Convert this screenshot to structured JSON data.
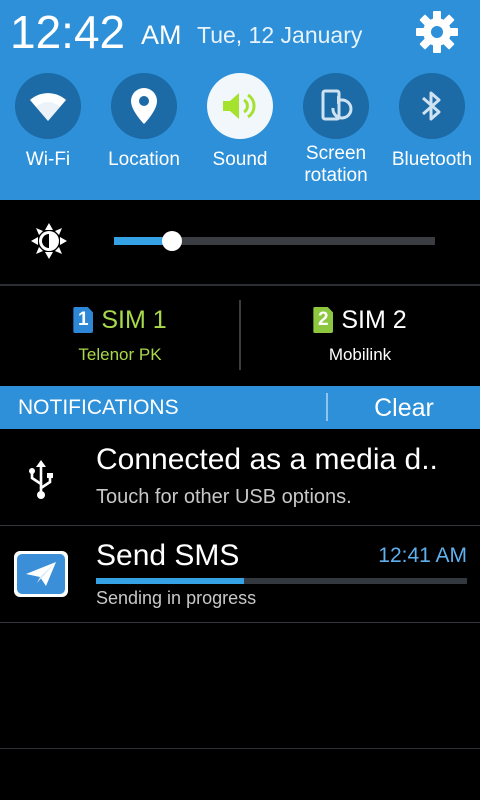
{
  "status": {
    "time": "12:42",
    "ampm": "AM",
    "date": "Tue, 12 January",
    "settings_icon": "gear-icon"
  },
  "quick_settings": [
    {
      "label": "Wi-Fi",
      "icon": "wifi-icon",
      "active": true
    },
    {
      "label": "Location",
      "icon": "location-pin-icon",
      "active": true
    },
    {
      "label": "Sound",
      "icon": "speaker-icon",
      "active": true
    },
    {
      "label_line1": "Screen",
      "label_line2": "rotation",
      "icon": "screen-rotation-icon",
      "active": false
    },
    {
      "label": "Bluetooth",
      "icon": "bluetooth-icon",
      "active": false
    }
  ],
  "brightness": {
    "icon": "brightness-icon",
    "level": 0.18
  },
  "sims": [
    {
      "badge": "1",
      "name": "SIM 1",
      "operator": "Telenor PK",
      "color": "#a8d94a",
      "badge_color": "#2e86d6"
    },
    {
      "badge": "2",
      "name": "SIM 2",
      "operator": "Mobilink",
      "color": "#ffffff",
      "badge_color": "#8dc63f"
    }
  ],
  "notifications_bar": {
    "title": "NOTIFICATIONS",
    "clear_label": "Clear"
  },
  "notifications": [
    {
      "icon": "usb-icon",
      "title": "Connected as a media d..",
      "subtitle": "Touch for other USB options."
    },
    {
      "icon": "send-sms-app-icon",
      "title": "Send SMS",
      "time": "12:41 AM",
      "subtitle": "Sending in progress",
      "progress": 0.4
    }
  ],
  "colors": {
    "accent": "#2d90d8",
    "toggle_circle": "#1c6aa6",
    "sound_active": "#a4e22e",
    "progress": "#36a2e6"
  }
}
